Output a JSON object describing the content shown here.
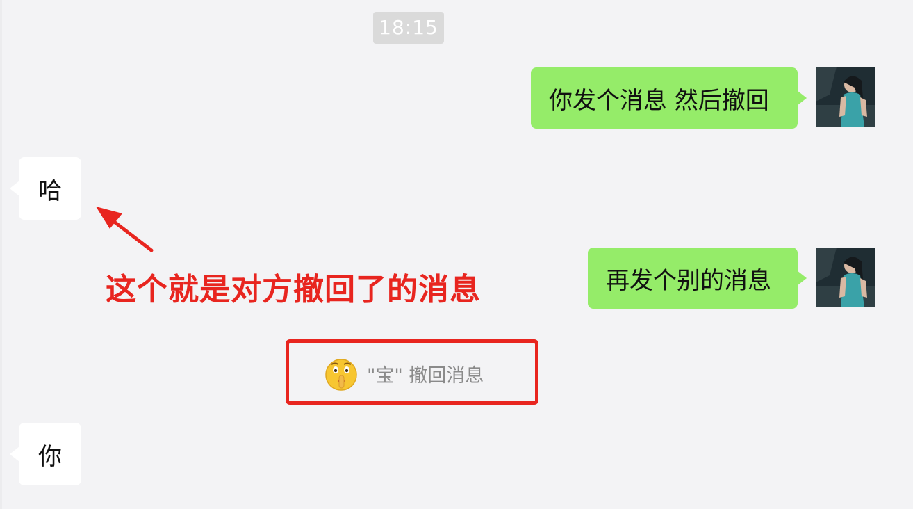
{
  "timestamp": "18:15",
  "messages": [
    {
      "direction": "sent",
      "text": "你发个消息 然后撤回"
    },
    {
      "direction": "received",
      "text": "哈"
    },
    {
      "direction": "sent",
      "text": "再发个别的消息"
    },
    {
      "direction": "received",
      "text": "你"
    }
  ],
  "annotation": "这个就是对方撤回了的消息",
  "recall_notice": {
    "icon": "shush-face-emoji-icon",
    "text": "\"宝\" 撤回消息"
  },
  "colors": {
    "background": "#f3f3f5",
    "sent_bubble": "#95ec69",
    "received_bubble": "#ffffff",
    "annotation": "#e8251f",
    "highlight_box": "#e8251f",
    "timestamp_bg": "#dadada"
  }
}
